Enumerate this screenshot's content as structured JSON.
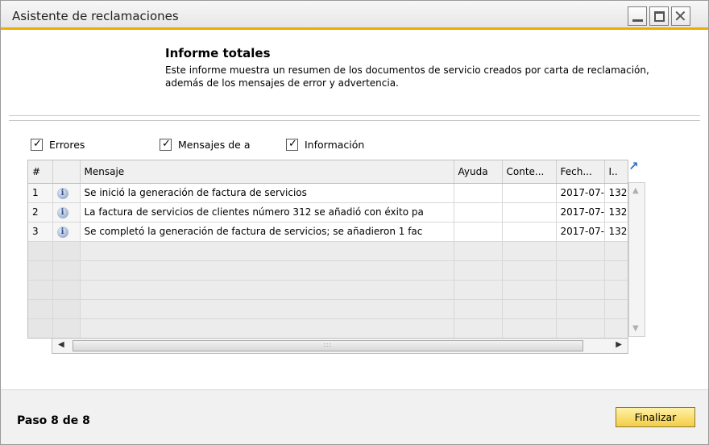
{
  "window": {
    "title": "Asistente de reclamaciones"
  },
  "header": {
    "heading": "Informe totales",
    "description": "Este informe muestra un resumen de los documentos de servicio creados por carta de reclamación, además de los mensajes de error y advertencia."
  },
  "filters": [
    {
      "label": "Errores",
      "checked": true
    },
    {
      "label": "Mensajes de a",
      "checked": true
    },
    {
      "label": "Información",
      "checked": true
    }
  ],
  "table": {
    "columns": [
      "#",
      "",
      "Mensaje",
      "Ayuda",
      "Conte...",
      "Fech...",
      "I.."
    ],
    "rows": [
      {
        "num": "1",
        "icon": "info-icon",
        "mensaje": "Se inició la generación de factura de servicios",
        "ayuda": "",
        "contenido": "",
        "fecha": "2017-07-",
        "i": "132"
      },
      {
        "num": "2",
        "icon": "info-icon",
        "mensaje": "La factura de servicios de clientes número 312 se añadió con éxito pa",
        "ayuda": "",
        "contenido": "",
        "fecha": "2017-07-",
        "i": "132"
      },
      {
        "num": "3",
        "icon": "info-icon",
        "mensaje": "Se completó la generación de factura de servicios; se añadieron 1 fac",
        "ayuda": "",
        "contenido": "",
        "fecha": "2017-07-",
        "i": "132"
      }
    ]
  },
  "footer": {
    "step": "Paso 8 de 8",
    "finish_label": "Finalizar"
  },
  "colors": {
    "accent": "#f0ab00",
    "button": "#f3cd47"
  }
}
